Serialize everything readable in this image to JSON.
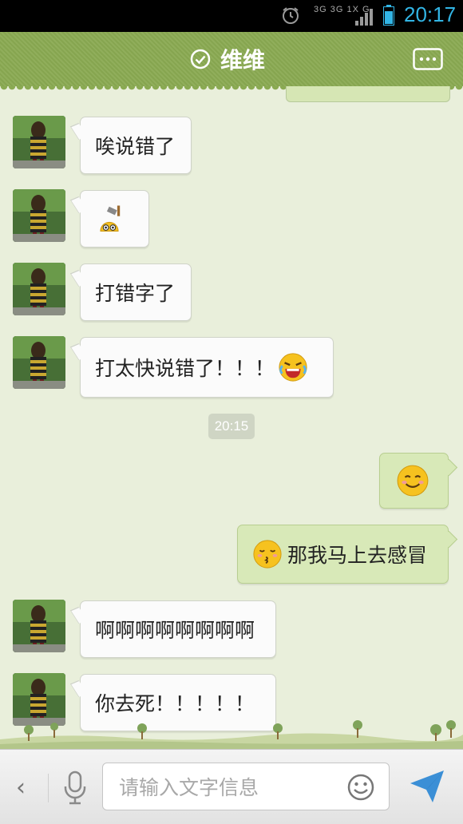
{
  "status_bar": {
    "network_label": "3G 3G 1X G",
    "time": "20:17"
  },
  "header": {
    "title": "维维"
  },
  "messages": [
    {
      "side": "left",
      "text": "唉说错了"
    },
    {
      "side": "left",
      "text": "",
      "emoji": "sweat-hammer-emoji"
    },
    {
      "side": "left",
      "text": "打错字了"
    },
    {
      "side": "left",
      "text": "打太快说错了！！！",
      "emoji": "crying-laughing-emoji"
    },
    {
      "side": "right",
      "text": "",
      "emoji": "smiling-emoji"
    },
    {
      "side": "right",
      "text": "那我马上去感冒",
      "emoji": "kissing-emoji"
    },
    {
      "side": "left",
      "text": "啊啊啊啊啊啊啊啊"
    },
    {
      "side": "left",
      "text": "你去死！！！！！"
    }
  ],
  "timestamp": "20:15",
  "input": {
    "placeholder": "请输入文字信息"
  },
  "colors": {
    "header": "#8aaa52",
    "background": "#e9efdb",
    "sent_bubble": "#d8e9b8",
    "received_bubble": "#fbfbfb",
    "accent": "#32b5e5"
  }
}
